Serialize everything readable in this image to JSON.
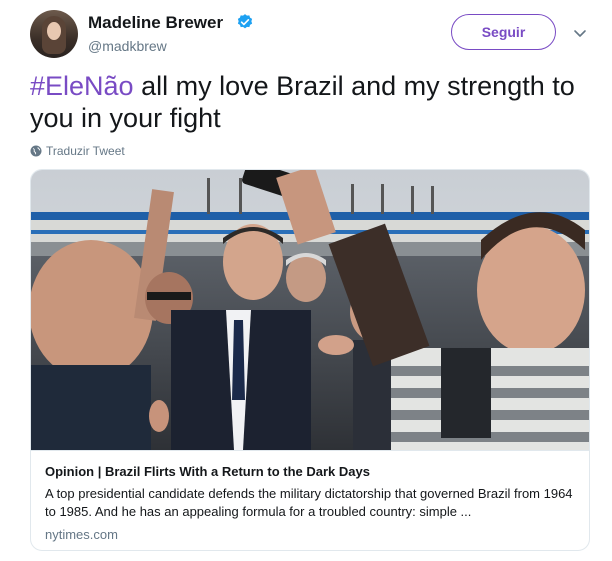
{
  "author": {
    "display_name": "Madeline Brewer",
    "username": "@madkbrew",
    "verified": true
  },
  "actions": {
    "follow_label": "Seguir"
  },
  "tweet": {
    "hashtag": "#EleNão",
    "text": " all my love Brazil and my strength to you in your fight",
    "translate_label": "Traduzir Tweet"
  },
  "card": {
    "title": "Opinion | Brazil Flirts With a Return to the Dark Days",
    "description": "A top presidential candidate defends the military dictatorship that governed Brazil from 1964 to 1985. And he has an appealing formula for a troubled country: simple ...",
    "domain": "nytimes.com"
  },
  "colors": {
    "accent": "#794bc4",
    "verified": "#1da1f2",
    "secondary_text": "#657786",
    "border": "#e1e8ed"
  }
}
